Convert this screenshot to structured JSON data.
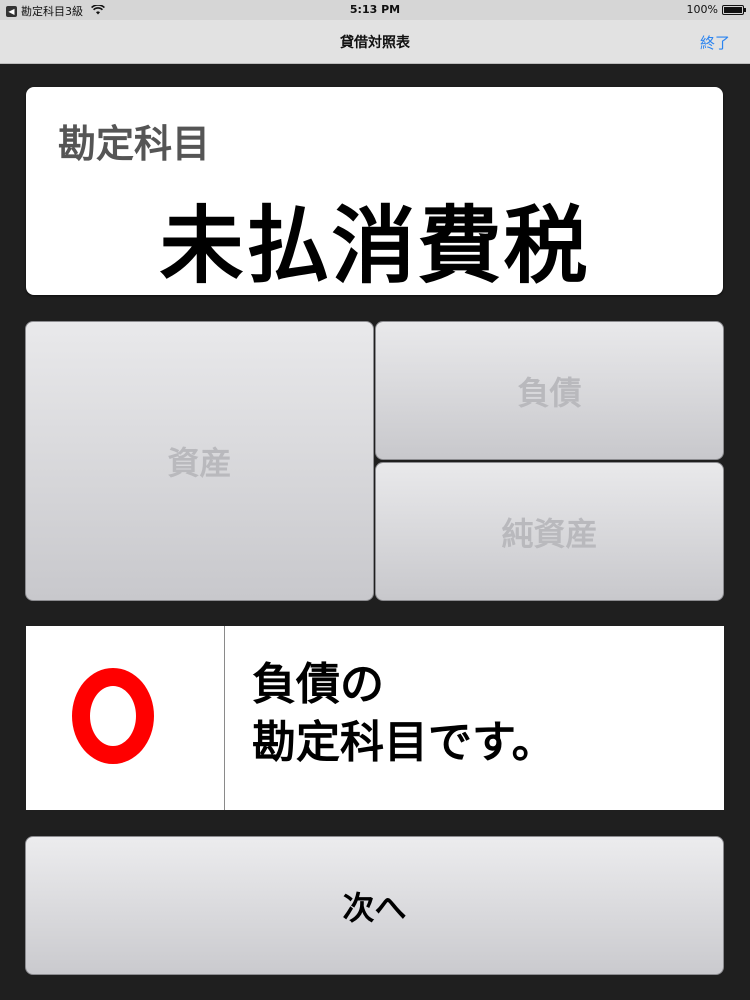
{
  "status_bar": {
    "back_app": "勘定科目3級",
    "time": "5:13 PM",
    "battery": "100%"
  },
  "nav": {
    "title": "貸借対照表",
    "done_label": "終了"
  },
  "account": {
    "label": "勘定科目",
    "name": "未払消費税"
  },
  "choices": {
    "assets": "資産",
    "liabilities": "負債",
    "equity": "純資産"
  },
  "result": {
    "mark": "correct-circle",
    "mark_color": "#ff0000",
    "line1": "負債の",
    "line2": "勘定科目です。"
  },
  "next_button": {
    "label": "次へ"
  },
  "colors": {
    "accent": "#2b84f0",
    "background": "#1f1f1f"
  }
}
